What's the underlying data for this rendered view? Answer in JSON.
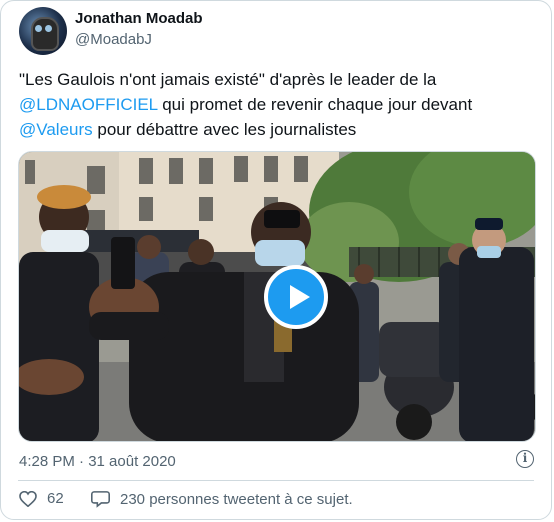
{
  "author": {
    "name": "Jonathan Moadab",
    "handle": "@MoadabJ"
  },
  "tweet": {
    "text_1": "\"Les Gaulois n'ont jamais existé\" d'après le leader de la",
    "mention_1": "@LDNAOFFICIEL",
    "text_2": " qui promet de revenir chaque jour devant",
    "mention_2": "@Valeurs",
    "text_3": " pour débattre avec les journalistes"
  },
  "timestamp": "4:28 PM · 31 août 2020",
  "engagement": {
    "likes": "62",
    "replies_text": "230 personnes tweetent à ce sujet."
  },
  "colors": {
    "accent": "#1d9bf0",
    "muted": "#536471",
    "border": "#cfd9de"
  },
  "icons": {
    "info": "info-icon",
    "like": "heart-icon",
    "reply": "speech-bubble-icon",
    "play": "play-icon"
  },
  "info_glyph": "i"
}
